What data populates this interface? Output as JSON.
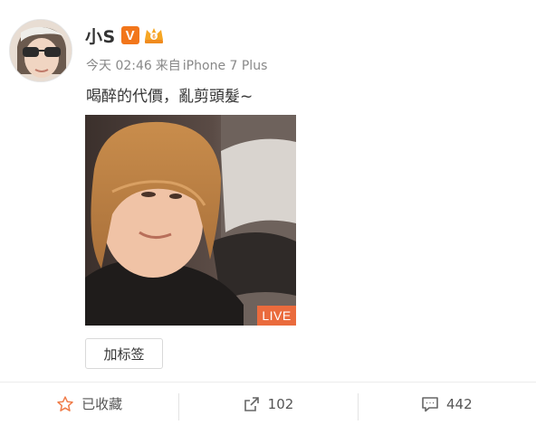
{
  "user": {
    "name": "小S",
    "verified_mark": "V"
  },
  "post": {
    "time": "今天 02:46",
    "source_prefix": "来自",
    "device": "iPhone 7 Plus",
    "text": "喝醉的代價，亂剪頭髮~",
    "live_label": "LIVE"
  },
  "tag_button_label": "加标签",
  "actions": {
    "favorite_label": "已收藏",
    "repost_count": "102",
    "comment_count": "442"
  },
  "colors": {
    "verified": "#f2761b",
    "live_badge": "#ea6b3d",
    "favorite_star": "#f07d4a"
  }
}
